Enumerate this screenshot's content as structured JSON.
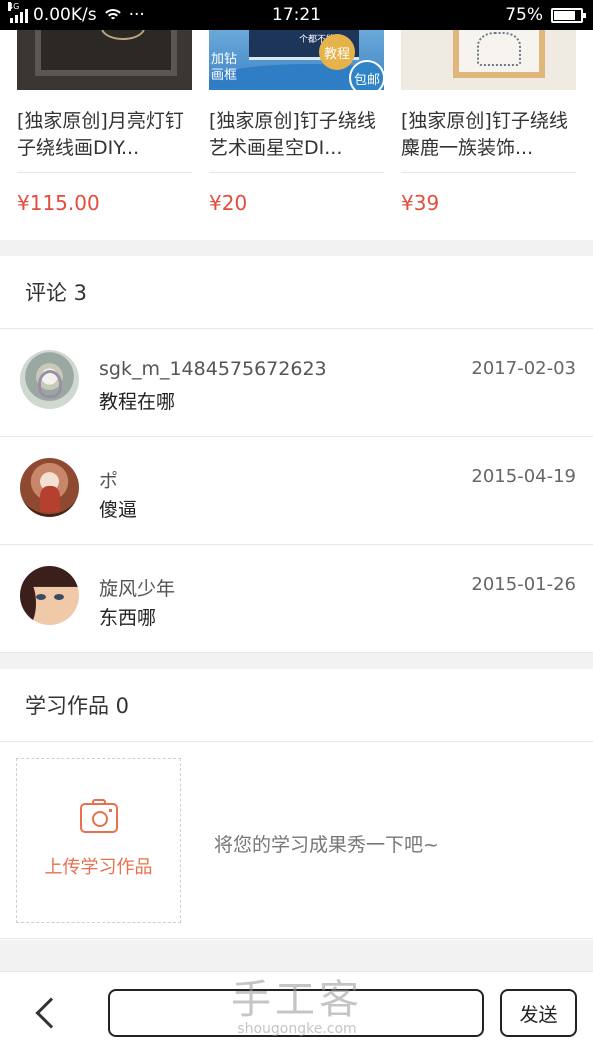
{
  "status_bar": {
    "network_type": "4G",
    "speed": "0.00K/s",
    "dots": "···",
    "time": "17:21",
    "battery": "75%",
    "battery_level": 0.75
  },
  "products": [
    {
      "title": "[独家原创]月亮灯钉子绕线画DIY...",
      "price": "¥115.00"
    },
    {
      "title": "[独家原创]钉子绕线艺术画星空DI...",
      "price": "¥20",
      "tag_left": "加钻画框",
      "badge_top": "教程",
      "badge_bottom": "包邮",
      "small_text": "个都不能少"
    },
    {
      "title": "[独家原创]钉子绕线麋鹿一族装饰...",
      "price": "¥39"
    }
  ],
  "comments": {
    "header": "评论 3",
    "items": [
      {
        "name": "sgk_m_1484575672623",
        "text": "教程在哪",
        "date": "2017-02-03"
      },
      {
        "name": "ポ",
        "text": "傻逼",
        "date": "2015-04-19"
      },
      {
        "name": "旋风少年",
        "text": "东西哪",
        "date": "2015-01-26"
      }
    ]
  },
  "works": {
    "header": "学习作品 0",
    "upload_label": "上传学习作品",
    "hint": "将您的学习成果秀一下吧~"
  },
  "bottom_bar": {
    "input_value": "",
    "send_label": "发送",
    "watermark_big": "手工客",
    "watermark_small": "shougongke.com"
  },
  "colors": {
    "price": "#e34d3c",
    "accent": "#e8704f",
    "section_gap": "#f2f2f2"
  }
}
